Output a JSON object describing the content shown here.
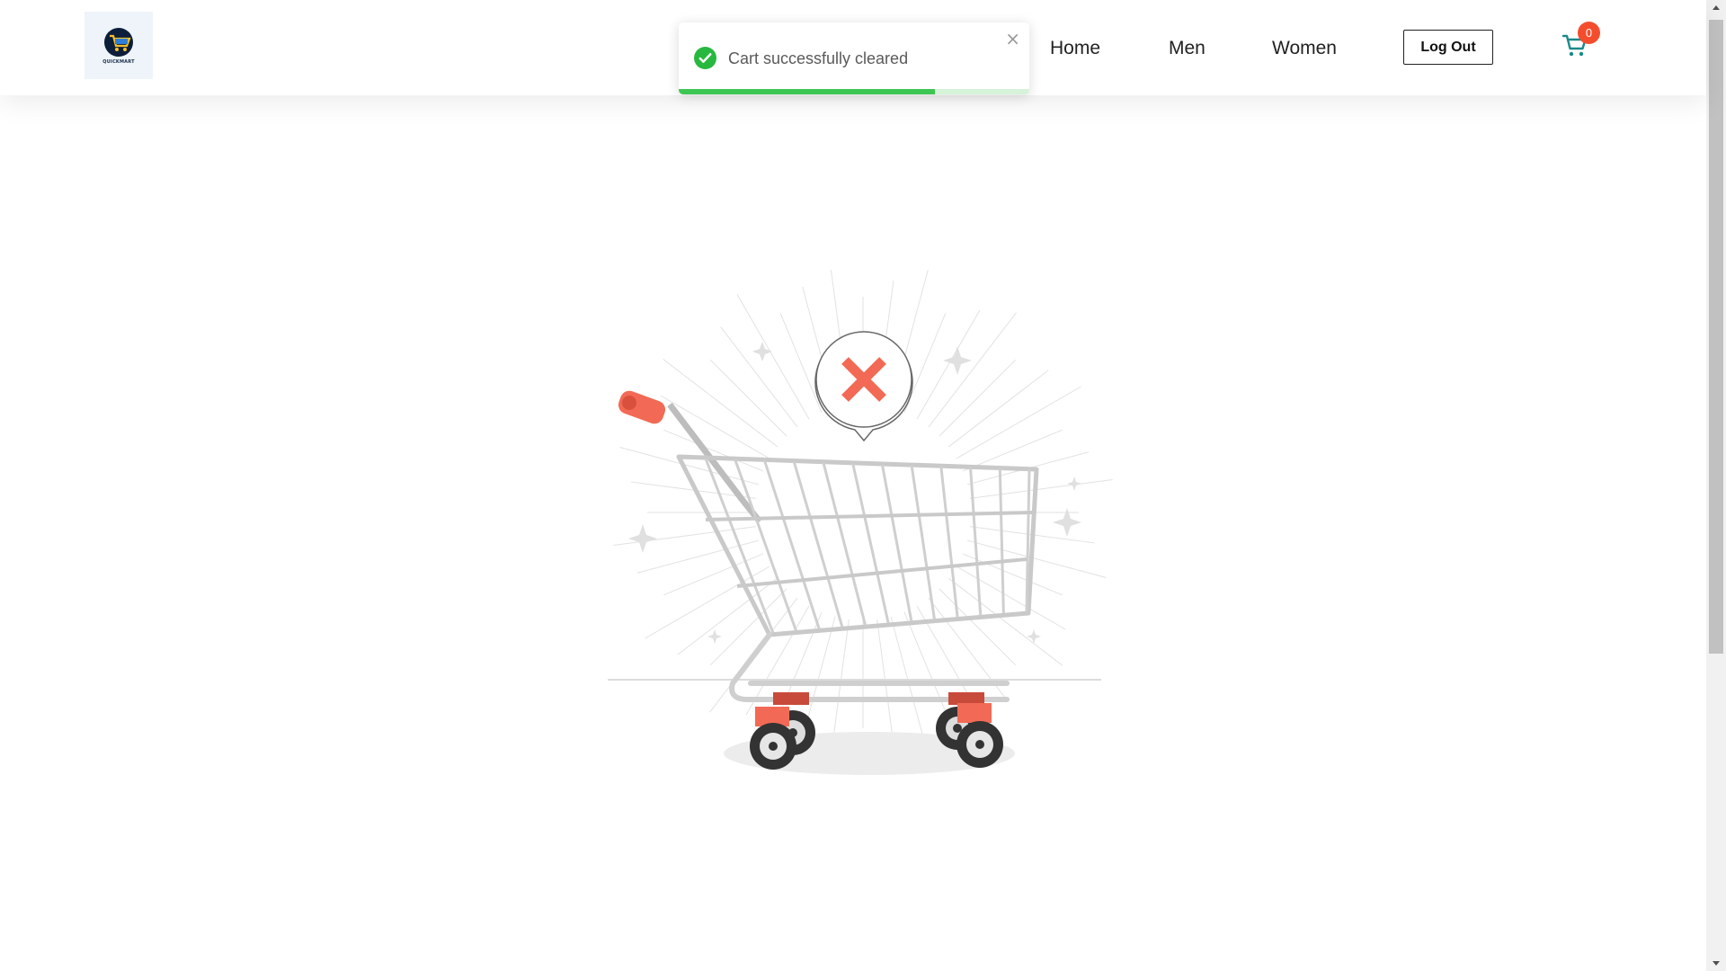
{
  "header": {
    "logo_text": "QUICKMART",
    "nav": [
      {
        "label": "Home"
      },
      {
        "label": "Men"
      },
      {
        "label": "Women"
      }
    ],
    "logout_label": "Log Out",
    "cart_count": "0",
    "icons": {
      "logo": "cart-logo-icon",
      "cart": "cart-icon"
    }
  },
  "toast": {
    "message": "Cart successfully cleared",
    "close_label": "×",
    "progress": 0.73,
    "icon": "check-circle-icon",
    "color": "#3ec654"
  },
  "empty_cart": {
    "illustration": "empty-shopping-cart-illustration"
  },
  "colors": {
    "accent": "#f44d2e",
    "cart_icon": "#1a8a8a",
    "success": "#3ec654"
  }
}
